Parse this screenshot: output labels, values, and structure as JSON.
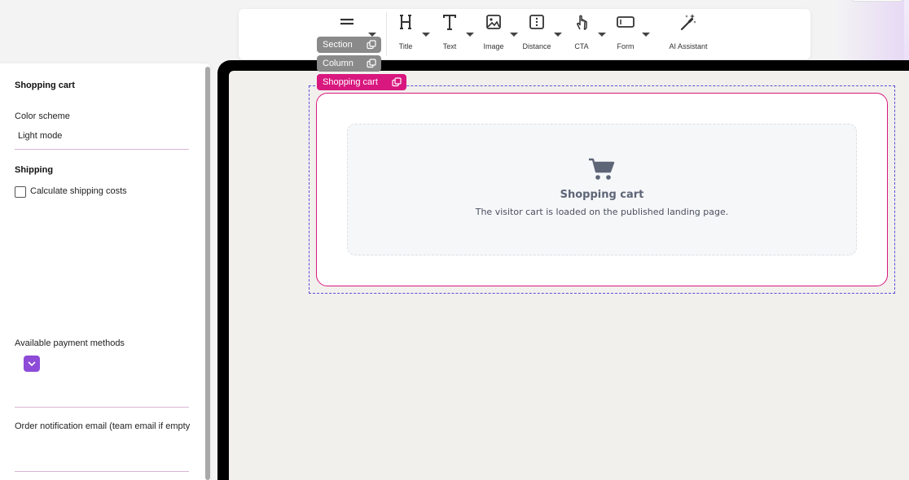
{
  "toolbar": {
    "items": [
      {
        "label": "",
        "icon": "section-handle-icon"
      },
      {
        "label": "Title",
        "icon": "heading-icon"
      },
      {
        "label": "Text",
        "icon": "text-icon"
      },
      {
        "label": "Image",
        "icon": "image-icon"
      },
      {
        "label": "Distance",
        "icon": "distance-icon"
      },
      {
        "label": "CTA",
        "icon": "pointer-hand-icon"
      },
      {
        "label": "Form",
        "icon": "form-field-icon"
      },
      {
        "label": "AI Assistant",
        "icon": "magic-wand-icon"
      }
    ]
  },
  "selection": {
    "section": "Section",
    "column": "Column",
    "element": "Shopping cart"
  },
  "panel": {
    "title": "Shopping cart",
    "color_scheme_label": "Color scheme",
    "color_scheme_value": "Light mode",
    "shipping_title": "Shipping",
    "calc_shipping_label": "Calculate shipping costs",
    "calc_shipping_checked": false,
    "payment_methods_label": "Available payment methods",
    "notification_email_label": "Order notification email (team email if empty"
  },
  "cart": {
    "title": "Shopping cart",
    "subtitle": "The visitor cart is loaded on the published landing page."
  },
  "colors": {
    "accent_pink": "#d9187f",
    "accent_purple": "#8e4bd8",
    "selection_blue": "#5b4fd6",
    "pill_grey": "#8a8a8a"
  }
}
